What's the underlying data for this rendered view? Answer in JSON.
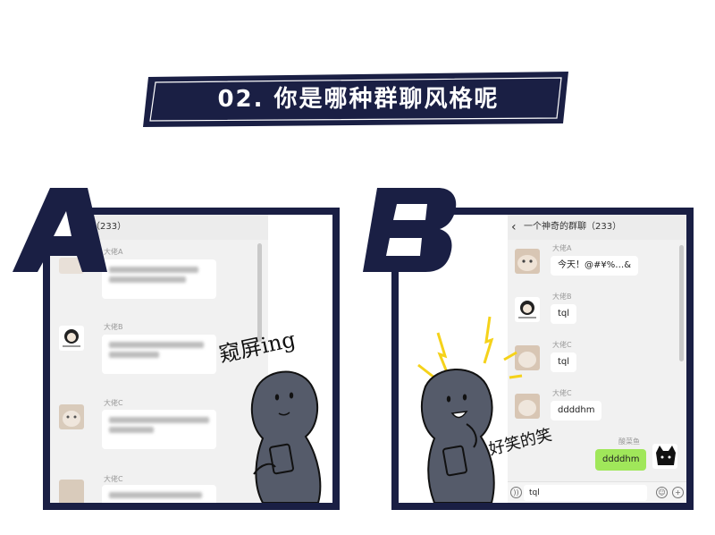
{
  "title": "02. 你是哪种群聊风格呢",
  "colors": {
    "navy": "#1a1f44",
    "chat_bg": "#f1f1f1",
    "bubble_mine": "#a0e75a",
    "accent_yellow": "#f5d21a"
  },
  "panel_a": {
    "letter": "A",
    "chat_title": "奇的群聊（233）",
    "messages": [
      {
        "sender": "大佬A"
      },
      {
        "sender": "大佬B"
      },
      {
        "sender": "大佬C"
      },
      {
        "sender": "大佬C"
      }
    ],
    "doodle_caption": "窥屏ing"
  },
  "panel_b": {
    "letter": "B",
    "chat_title": "一个神奇的群聊（233）",
    "messages": [
      {
        "sender": "大佬A",
        "text": "今天！@#¥%…&"
      },
      {
        "sender": "大佬B",
        "text": "tql"
      },
      {
        "sender": "大佬C",
        "text": "tql"
      },
      {
        "sender": "大佬C",
        "text": "ddddhm"
      }
    ],
    "my_sender": "酸菜鱼",
    "my_message": "ddddhm",
    "input_value": "tql",
    "doodle_caption": "好笑的笑"
  }
}
